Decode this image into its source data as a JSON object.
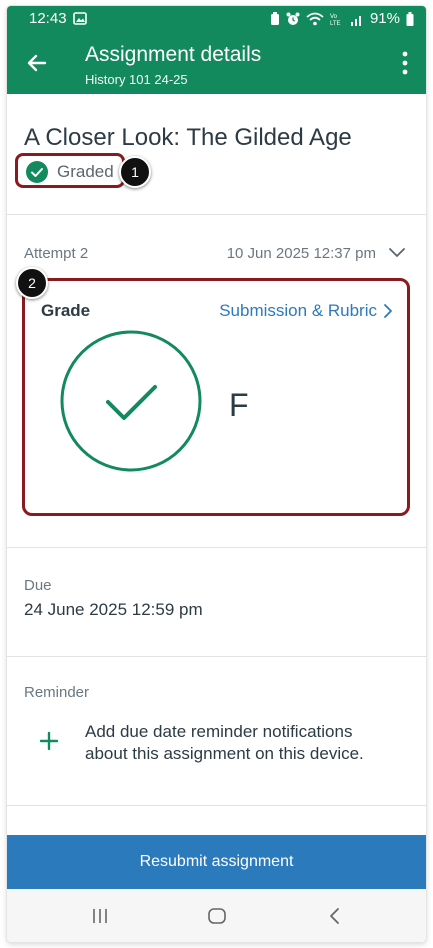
{
  "status_bar": {
    "time": "12:43",
    "battery_percent": "91%",
    "icons": [
      "gallery-icon",
      "battery-saver-icon",
      "alarm-icon",
      "wifi-icon",
      "volte-icon",
      "signal-icon",
      "battery-icon"
    ]
  },
  "header": {
    "title": "Assignment details",
    "subtitle": "History 101 24-25",
    "back_icon": "arrow-left-icon",
    "menu_icon": "more-vertical-icon"
  },
  "assignment": {
    "title": "A Closer Look: The Gilded Age",
    "status_label": "Graded",
    "status_icon": "check-circle-icon"
  },
  "attempt": {
    "label": "Attempt 2",
    "date": "10 Jun 2025 12:37 pm"
  },
  "grade": {
    "label": "Grade",
    "link_label": "Submission & Rubric",
    "letter": "F"
  },
  "due": {
    "label": "Due",
    "value": "24 June 2025 12:59 pm"
  },
  "reminder": {
    "label": "Reminder",
    "text": "Add due date reminder notifications about this assignment on this device."
  },
  "resubmit_label": "Resubmit assignment",
  "callouts": [
    "1",
    "2"
  ],
  "colors": {
    "brand_green": "#138a5e",
    "link_blue": "#2b7abc",
    "annotation_red": "#8a1a1f"
  }
}
